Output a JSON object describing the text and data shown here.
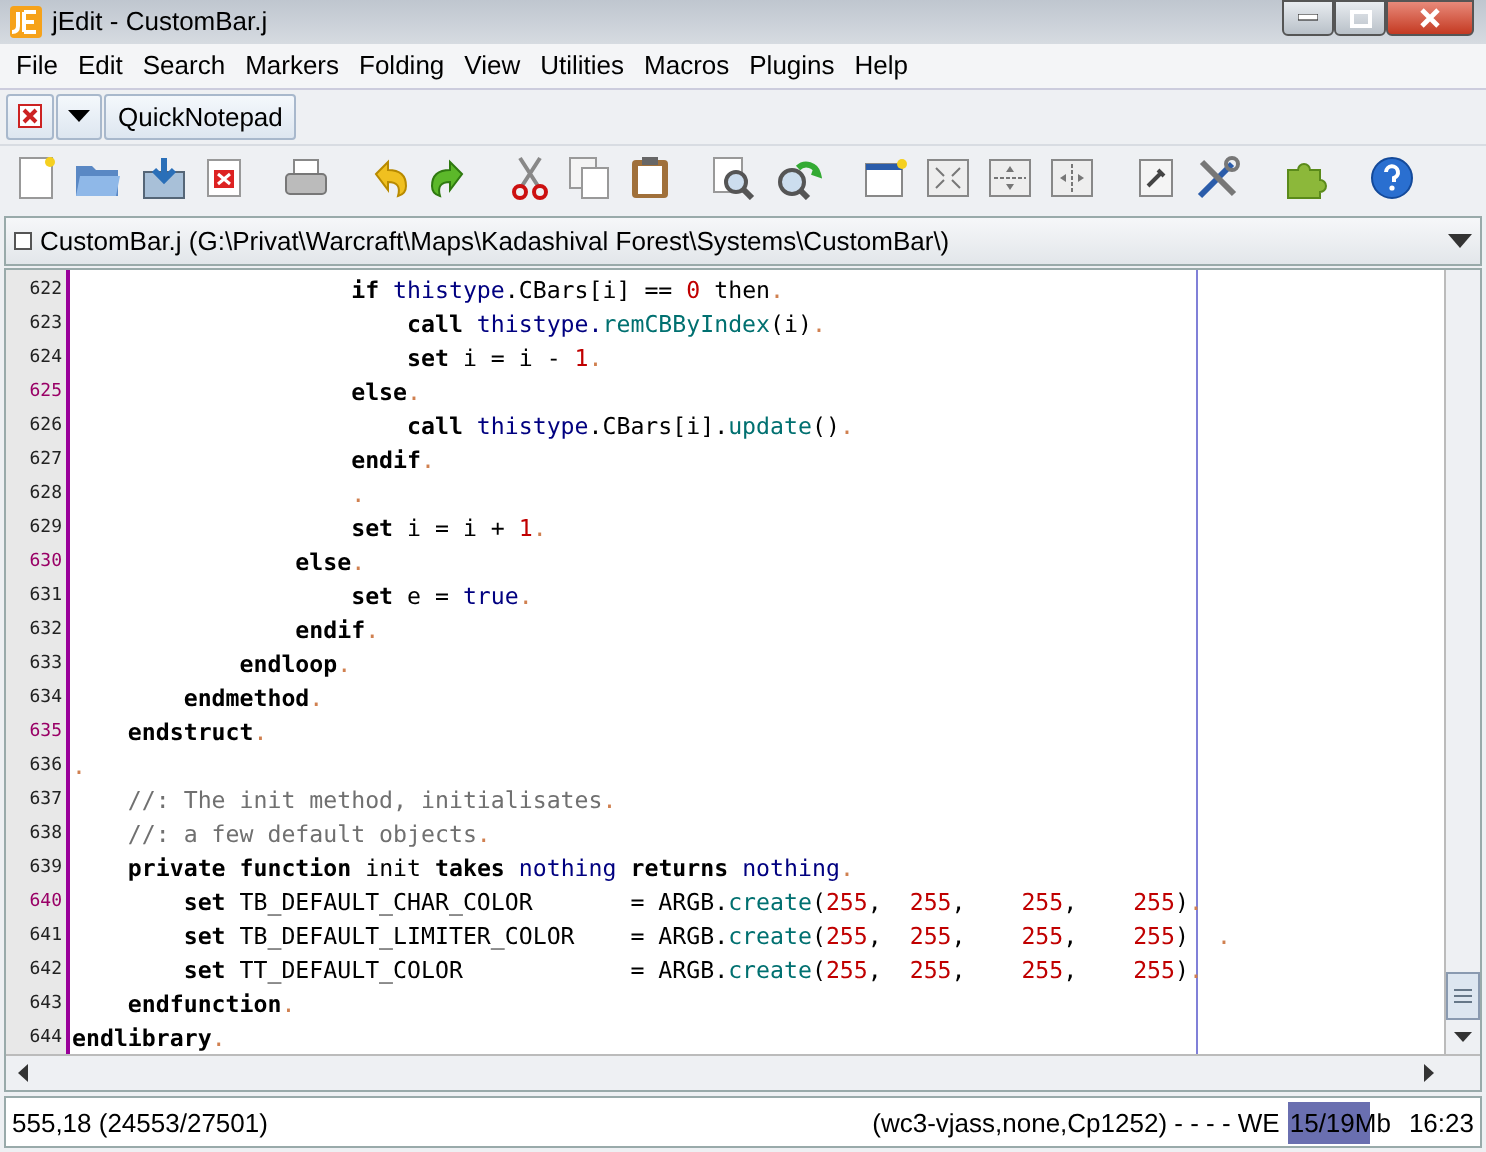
{
  "window": {
    "title": "jEdit - CustomBar.j"
  },
  "menu": [
    "File",
    "Edit",
    "Search",
    "Markers",
    "Folding",
    "View",
    "Utilities",
    "Macros",
    "Plugins",
    "Help"
  ],
  "dockable_bar": {
    "button": "QuickNotepad"
  },
  "buffer_switcher": {
    "label": "CustomBar.j (G:\\Privat\\Warcraft\\Maps\\Kadashival Forest\\Systems\\CustomBar\\)"
  },
  "editor": {
    "lines": [
      {
        "number": "622",
        "highlighted": false,
        "tokens": [
          {
            "kind": "kw",
            "text": "                    if "
          },
          {
            "kind": "type",
            "text": "thistype"
          },
          {
            "kind": "text",
            "text": ".CBars[i] == "
          },
          {
            "kind": "num",
            "text": "0"
          },
          {
            "kind": "text",
            "text": " then"
          },
          {
            "kind": "eol",
            "text": "."
          }
        ]
      },
      {
        "number": "623",
        "highlighted": false,
        "tokens": [
          {
            "kind": "kw",
            "text": "                        call "
          },
          {
            "kind": "type",
            "text": "thistype."
          },
          {
            "kind": "fn",
            "text": "remCBByIndex"
          },
          {
            "kind": "text",
            "text": "(i)"
          },
          {
            "kind": "eol",
            "text": "."
          }
        ]
      },
      {
        "number": "624",
        "highlighted": false,
        "tokens": [
          {
            "kind": "kw",
            "text": "                        set"
          },
          {
            "kind": "text",
            "text": " i = i - "
          },
          {
            "kind": "num",
            "text": "1"
          },
          {
            "kind": "eol",
            "text": "."
          }
        ]
      },
      {
        "number": "625",
        "highlighted": true,
        "tokens": [
          {
            "kind": "kw",
            "text": "                    else"
          },
          {
            "kind": "eol",
            "text": "."
          }
        ]
      },
      {
        "number": "626",
        "highlighted": false,
        "tokens": [
          {
            "kind": "kw",
            "text": "                        call "
          },
          {
            "kind": "type",
            "text": "thistype"
          },
          {
            "kind": "text",
            "text": ".CBars[i]."
          },
          {
            "kind": "fn",
            "text": "update"
          },
          {
            "kind": "text",
            "text": "()"
          },
          {
            "kind": "eol",
            "text": "."
          }
        ]
      },
      {
        "number": "627",
        "highlighted": false,
        "tokens": [
          {
            "kind": "kw",
            "text": "                    endif"
          },
          {
            "kind": "eol",
            "text": "."
          }
        ]
      },
      {
        "number": "628",
        "highlighted": false,
        "tokens": [
          {
            "kind": "eol",
            "text": "                    ."
          }
        ]
      },
      {
        "number": "629",
        "highlighted": false,
        "tokens": [
          {
            "kind": "kw",
            "text": "                    set"
          },
          {
            "kind": "text",
            "text": " i = i + "
          },
          {
            "kind": "num",
            "text": "1"
          },
          {
            "kind": "eol",
            "text": "."
          }
        ]
      },
      {
        "number": "630",
        "highlighted": true,
        "tokens": [
          {
            "kind": "kw",
            "text": "                else"
          },
          {
            "kind": "eol",
            "text": "."
          }
        ]
      },
      {
        "number": "631",
        "highlighted": false,
        "tokens": [
          {
            "kind": "kw",
            "text": "                    set"
          },
          {
            "kind": "text",
            "text": " e = "
          },
          {
            "kind": "type",
            "text": "true"
          },
          {
            "kind": "eol",
            "text": "."
          }
        ]
      },
      {
        "number": "632",
        "highlighted": false,
        "tokens": [
          {
            "kind": "kw",
            "text": "                endif"
          },
          {
            "kind": "eol",
            "text": "."
          }
        ]
      },
      {
        "number": "633",
        "highlighted": false,
        "tokens": [
          {
            "kind": "kw",
            "text": "            endloop"
          },
          {
            "kind": "eol",
            "text": "."
          }
        ]
      },
      {
        "number": "634",
        "highlighted": false,
        "tokens": [
          {
            "kind": "kw",
            "text": "        endmethod"
          },
          {
            "kind": "eol",
            "text": "."
          }
        ]
      },
      {
        "number": "635",
        "highlighted": true,
        "tokens": [
          {
            "kind": "kw",
            "text": "    endstruct"
          },
          {
            "kind": "eol",
            "text": "."
          }
        ]
      },
      {
        "number": "636",
        "highlighted": false,
        "tokens": [
          {
            "kind": "eol",
            "text": "."
          }
        ]
      },
      {
        "number": "637",
        "highlighted": false,
        "tokens": [
          {
            "kind": "comment",
            "text": "    //: The init method, initialisates"
          },
          {
            "kind": "eol",
            "text": "."
          }
        ]
      },
      {
        "number": "638",
        "highlighted": false,
        "tokens": [
          {
            "kind": "comment",
            "text": "    //: a few default objects"
          },
          {
            "kind": "eol",
            "text": "."
          }
        ]
      },
      {
        "number": "639",
        "highlighted": false,
        "tokens": [
          {
            "kind": "kw",
            "text": "    private function"
          },
          {
            "kind": "text",
            "text": " init "
          },
          {
            "kind": "kw",
            "text": "takes "
          },
          {
            "kind": "type",
            "text": "nothing "
          },
          {
            "kind": "kw",
            "text": "returns "
          },
          {
            "kind": "type",
            "text": "nothing"
          },
          {
            "kind": "eol",
            "text": "."
          }
        ]
      },
      {
        "number": "640",
        "highlighted": true,
        "tokens": [
          {
            "kind": "kw",
            "text": "        set"
          },
          {
            "kind": "text",
            "text": " TB_DEFAULT_CHAR_COLOR       = ARGB."
          },
          {
            "kind": "fn",
            "text": "create"
          },
          {
            "kind": "text",
            "text": "("
          },
          {
            "kind": "num",
            "text": "255"
          },
          {
            "kind": "text",
            "text": ",  "
          },
          {
            "kind": "num",
            "text": "255"
          },
          {
            "kind": "text",
            "text": ",    "
          },
          {
            "kind": "num",
            "text": "255"
          },
          {
            "kind": "text",
            "text": ",    "
          },
          {
            "kind": "num",
            "text": "255"
          },
          {
            "kind": "text",
            "text": ")"
          },
          {
            "kind": "eol",
            "text": "."
          }
        ]
      },
      {
        "number": "641",
        "highlighted": false,
        "tokens": [
          {
            "kind": "kw",
            "text": "        set"
          },
          {
            "kind": "text",
            "text": " TB_DEFAULT_LIMITER_COLOR    = ARGB."
          },
          {
            "kind": "fn",
            "text": "create"
          },
          {
            "kind": "text",
            "text": "("
          },
          {
            "kind": "num",
            "text": "255"
          },
          {
            "kind": "text",
            "text": ",  "
          },
          {
            "kind": "num",
            "text": "255"
          },
          {
            "kind": "text",
            "text": ",    "
          },
          {
            "kind": "num",
            "text": "255"
          },
          {
            "kind": "text",
            "text": ",    "
          },
          {
            "kind": "num",
            "text": "255"
          },
          {
            "kind": "text",
            "text": ")"
          },
          {
            "kind": "eol",
            "text": "  ."
          }
        ]
      },
      {
        "number": "642",
        "highlighted": false,
        "tokens": [
          {
            "kind": "kw",
            "text": "        set"
          },
          {
            "kind": "text",
            "text": " TT_DEFAULT_COLOR            = ARGB."
          },
          {
            "kind": "fn",
            "text": "create"
          },
          {
            "kind": "text",
            "text": "("
          },
          {
            "kind": "num",
            "text": "255"
          },
          {
            "kind": "text",
            "text": ",  "
          },
          {
            "kind": "num",
            "text": "255"
          },
          {
            "kind": "text",
            "text": ",    "
          },
          {
            "kind": "num",
            "text": "255"
          },
          {
            "kind": "text",
            "text": ",    "
          },
          {
            "kind": "num",
            "text": "255"
          },
          {
            "kind": "text",
            "text": ")"
          },
          {
            "kind": "eol",
            "text": "."
          }
        ]
      },
      {
        "number": "643",
        "highlighted": false,
        "tokens": [
          {
            "kind": "kw",
            "text": "    endfunction"
          },
          {
            "kind": "eol",
            "text": "."
          }
        ]
      },
      {
        "number": "644",
        "highlighted": false,
        "tokens": [
          {
            "kind": "kw",
            "text": "endlibrary"
          },
          {
            "kind": "eol",
            "text": "."
          }
        ]
      }
    ]
  },
  "status_bar": {
    "position": "555,18 (24553/27501)",
    "mode": "(wc3-vjass,none,Cp1252) - - - - WE",
    "memory": {
      "text": "15/19Mb",
      "level": 0.79
    },
    "time": "16:23"
  }
}
